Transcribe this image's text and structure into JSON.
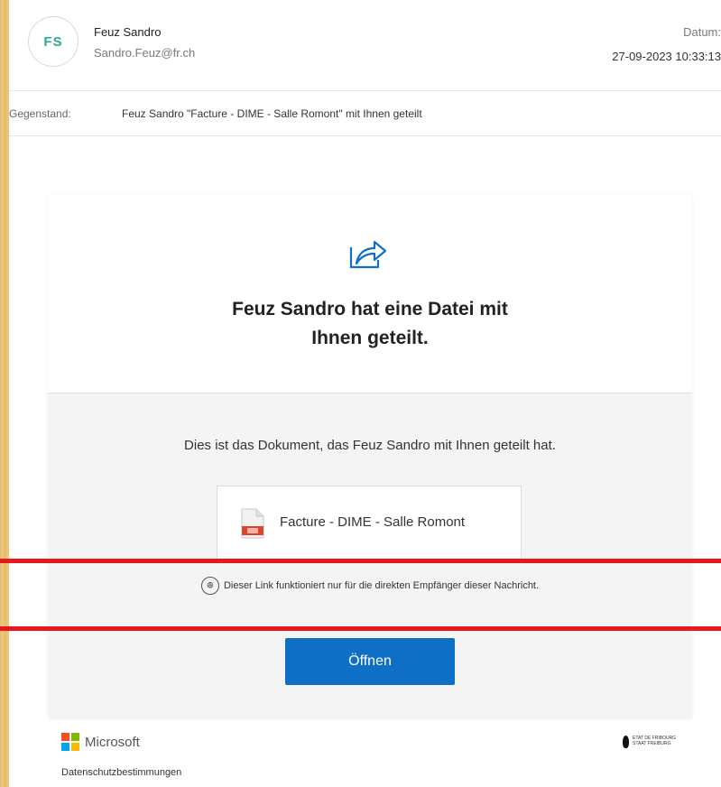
{
  "email": {
    "avatar_initials": "FS",
    "sender_name": "Feuz Sandro",
    "sender_email": "Sandro.Feuz@fr.ch",
    "date_label": "Datum:",
    "date_value": "27-09-2023 10:33:13",
    "subject_label": "Gegenstand:",
    "subject_text": "Feuz Sandro \"Facture - DIME - Salle Romont\" mit Ihnen geteilt"
  },
  "card": {
    "share_icon": "share-arrow-icon",
    "title_line1": "Feuz Sandro hat eine Datei mit",
    "title_line2": "Ihnen geteilt.",
    "description": "Dies ist das Dokument, das Feuz Sandro mit Ihnen geteilt hat.",
    "file_icon": "pdf-file-icon",
    "file_name": "Facture - DIME - Salle Romont",
    "note_icon": "people-icon",
    "note_text": "Dieser Link funktioniert nur für die direkten Empfänger dieser Nachricht.",
    "open_button": "Öffnen"
  },
  "footer": {
    "brand": "Microsoft",
    "privacy_link": "Datenschutzbestimmungen",
    "org_logo_text": "ETAT DE FRIBOURG\nSTAAT FREIBURG"
  },
  "colors": {
    "accent_blue": "#0f6fc6",
    "avatar_text": "#2fa892",
    "highlight_red": "#e8161d",
    "background_wood": "#e4bf6e"
  }
}
